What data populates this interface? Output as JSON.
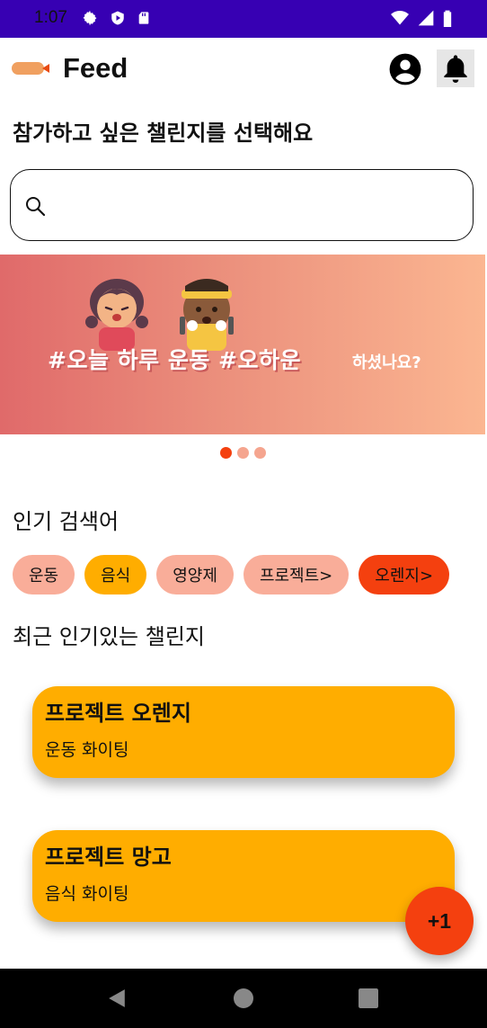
{
  "status_bar": {
    "time": "1:07",
    "background": "#3700B3"
  },
  "app_bar": {
    "title": "Feed",
    "account_icon": "account-circle-icon",
    "notification_icon": "bell-icon"
  },
  "subtitle": "참가하고 싶은 챌린지를 선택해요",
  "search": {
    "value": "",
    "placeholder": ""
  },
  "banner": {
    "main_text": "#오늘 하루 운동 #오하운",
    "sub_text": "하셨나요?",
    "pager_count": 3,
    "active_index": 0
  },
  "popular": {
    "title": "인기 검색어",
    "chips": [
      {
        "label": "운동",
        "color": "#f9ad99"
      },
      {
        "label": "음식",
        "color": "#ffad00"
      },
      {
        "label": "영양제",
        "color": "#f9ad99"
      },
      {
        "label": "프로젝트>",
        "color": "#f9ad99"
      },
      {
        "label": "오렌지>",
        "color": "#f4400f"
      }
    ]
  },
  "recent": {
    "title": "최근 인기있는 챌린지",
    "cards": [
      {
        "title": "프로젝트 오렌지",
        "subtitle": "운동 화이팅"
      },
      {
        "title": "프로젝트 망고",
        "subtitle": "음식 화이팅"
      }
    ]
  },
  "fab": {
    "label": "+1"
  },
  "colors": {
    "accent": "#f4400f",
    "card": "#ffad00",
    "chip_light": "#f9ad99"
  }
}
